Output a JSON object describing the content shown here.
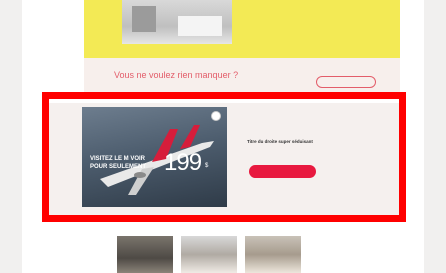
{
  "hero": {
    "text": "",
    "more_link": ""
  },
  "newsletter": {
    "title": "Vous ne voulez rien manquer ?",
    "subtitle": "",
    "button": ""
  },
  "promo": {
    "ad_caption": "VISITEZ LE M  VOIR POUR SEULEMENT",
    "ad_price": "199",
    "ad_price_unit": "$",
    "title": "Titre du droite super séduisant",
    "description": "",
    "button": "",
    "accent_color": "#e8193f"
  },
  "bottom": {
    "text": ""
  },
  "highlight_color": "#ff0000"
}
